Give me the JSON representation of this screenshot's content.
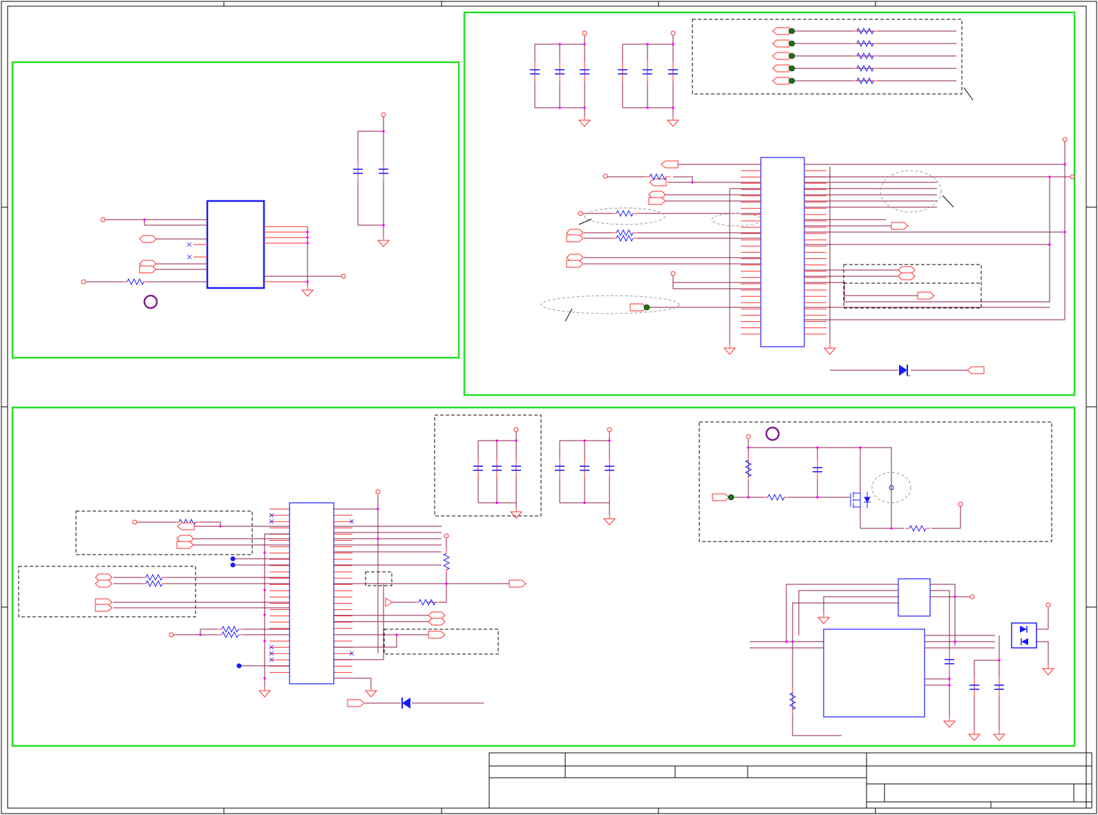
{
  "colors": {
    "wire": "#8b1a4a",
    "pin": "#ff2a2a",
    "junction": "#ff00ff",
    "component_body": "#1a1aff",
    "block_border": "#22e022",
    "frame": "#000000",
    "connector_dot": "#137a13",
    "annotation": "#9a9a9a",
    "ring_marker": "#7a1a8a"
  },
  "icons": [
    "resistor-icon",
    "capacitor-icon",
    "ground-icon",
    "power-flag-icon",
    "diode-icon",
    "mosfet-icon",
    "net-port-icon",
    "no-connect-icon"
  ]
}
